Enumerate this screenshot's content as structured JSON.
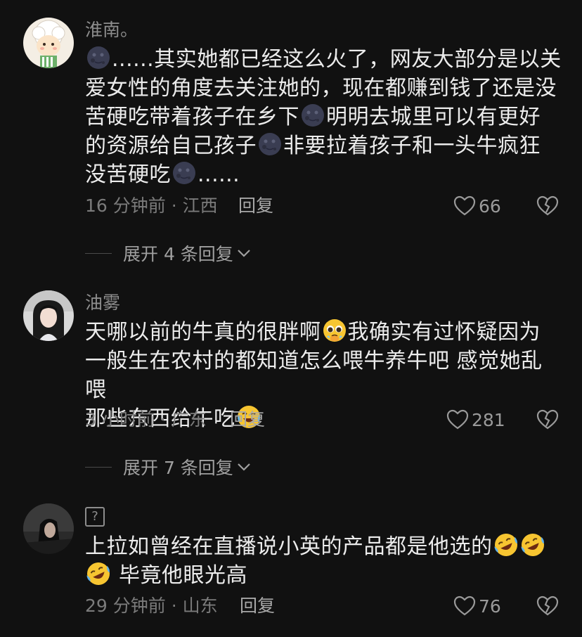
{
  "colors": {
    "background": "#111111",
    "text": "#ececec",
    "muted": "#8d8d8d"
  },
  "comments": [
    {
      "username": "淮南。",
      "avatar": "cartoon-sheep-avatar",
      "text": {
        "l1": "......其实她都已经这么火了，网友大部分是以关",
        "l2": "爱女性的角度去关注她的，现在都赚到钱了还是没",
        "l3a": "苦硬吃带着孩子在乡下",
        "l3b": "明明去城里可以有更好",
        "l4a": "的资源给自己孩子",
        "l4b": "非要拉着孩子和一头牛疯狂",
        "l5a": "没苦硬吃",
        "l5b": "......"
      },
      "emoji": "new-moon-face",
      "time": "16 分钟前 · 江西",
      "reply_label": "回复",
      "likes": "66",
      "expand_label": "展开 4 条回复"
    },
    {
      "username": "油雾",
      "avatar": "girl-photo-avatar",
      "text": {
        "l1a": "天哪以前的牛真的很胖啊",
        "l1b": "我确实有过怀疑因为",
        "l2": "一般生在农村的都知道怎么喂牛养牛吧 感觉她乱喂",
        "l3": "那些东西给牛吃"
      },
      "time": "3 小时前 · 广东",
      "reply_label": "回复",
      "likes": "281",
      "expand_label": "展开 7 条回复"
    },
    {
      "username": "?",
      "avatar": "dark-photo-avatar",
      "text": {
        "l1": "上拉如曾经在直播说小英的产品都是他选的",
        "l2": "毕竟他眼光高"
      },
      "time": "29 分钟前 · 山东",
      "reply_label": "回复",
      "likes": "76"
    }
  ]
}
